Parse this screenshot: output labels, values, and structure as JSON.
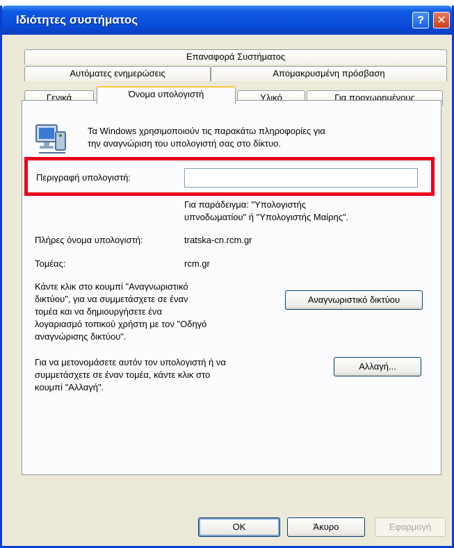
{
  "window": {
    "title": "Ιδιότητες συστήματος",
    "help_glyph": "?",
    "close_glyph": "✕"
  },
  "tabs": {
    "row1": [
      "Επαναφορά Συστήματος"
    ],
    "row2": [
      "Αυτόματες ενημερώσεις",
      "Απομακρυσμένη πρόσβαση"
    ],
    "row3": [
      "Γενικά",
      "Όνομα υπολογιστή",
      "Υλικό",
      "Για προχωρημένους"
    ],
    "active": "Όνομα υπολογιστή"
  },
  "content": {
    "intro_line1": "Τα Windows χρησιμοποιούν τις παρακάτω πληροφορίες για",
    "intro_line2": "την αναγνώριση του υπολογιστή σας στο δίκτυο.",
    "description_label": "Περιγραφή υπολογιστή:",
    "description_value": "",
    "example_line1": "Για παράδειγμα: \"Υπολογιστής",
    "example_line2": "υπνοδωματίου\" ή \"Υπολογιστής Μαίρης\".",
    "full_name_label": "Πλήρες όνομα υπολογιστή:",
    "full_name_value": "tratska-cn.rcm.gr",
    "domain_label": "Τομέας:",
    "domain_value": "rcm.gr",
    "netid_text": [
      "Κάντε κλικ στο κουμπί \"Αναγνωριστικό",
      "δικτύου\", για να συμμετάσχετε σε έναν",
      "τομέα και να δημιουργήσετε ένα",
      "λογαριασμό τοπικού χρήστη με τον \"Οδηγό",
      "αναγνώρισης δικτύου\"."
    ],
    "netid_button": "Αναγνωριστικό δικτύου",
    "rename_text": [
      "Για να μετονομάσετε αυτόν τον υπολογιστή ή να",
      "συμμετάσχετε σε έναν τομέα, κάντε κλικ στο",
      "κουμπί \"Αλλαγή\"."
    ],
    "change_button": "Αλλαγή..."
  },
  "footer": {
    "ok": "OK",
    "cancel": "Άκυρο",
    "apply": "Εφαρμογή"
  },
  "colors": {
    "highlight": "#E8001C",
    "titlebar": "#0A4BD6",
    "face": "#ECE9D8"
  },
  "icons": {
    "computer": "computer-network-icon"
  }
}
